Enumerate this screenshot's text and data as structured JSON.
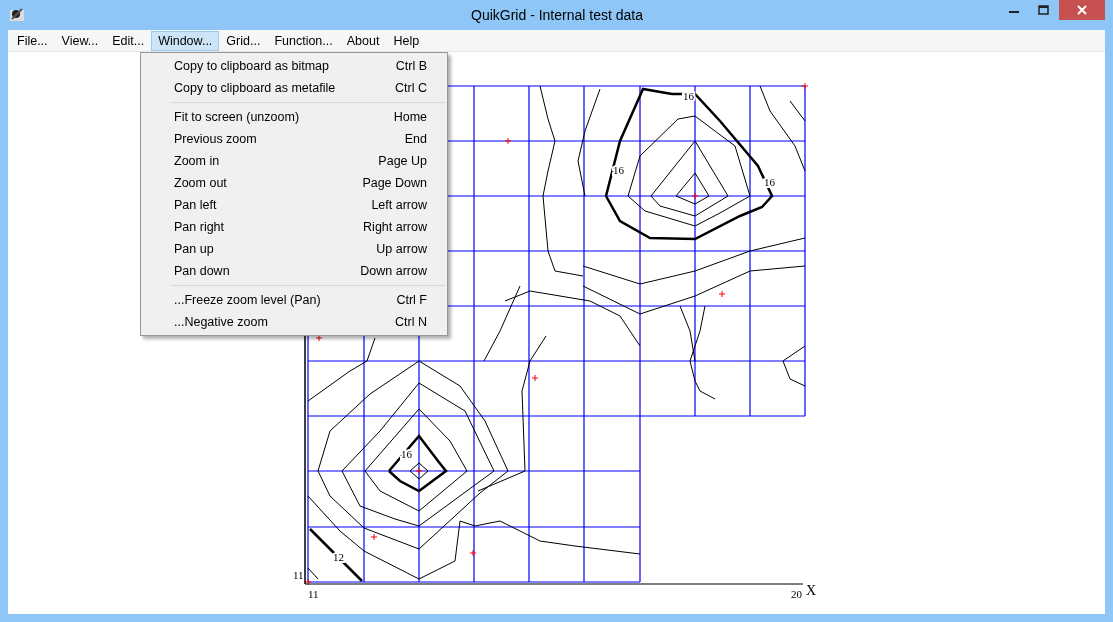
{
  "window": {
    "title": "QuikGrid - Internal test data"
  },
  "menu_bar": [
    {
      "label": "File...",
      "selected": false
    },
    {
      "label": "View...",
      "selected": false
    },
    {
      "label": "Edit...",
      "selected": false
    },
    {
      "label": "Window...",
      "selected": true
    },
    {
      "label": "Grid...",
      "selected": false
    },
    {
      "label": "Function...",
      "selected": false
    },
    {
      "label": "About",
      "selected": false
    },
    {
      "label": "Help",
      "selected": false
    }
  ],
  "dropdown": {
    "groups": [
      [
        {
          "label": "Copy to clipboard as bitmap",
          "shortcut": "Ctrl B"
        },
        {
          "label": "Copy to clipboard as metafile",
          "shortcut": "Ctrl C"
        }
      ],
      [
        {
          "label": "Fit to screen (unzoom)",
          "shortcut": "Home"
        },
        {
          "label": "Previous zoom",
          "shortcut": "End"
        },
        {
          "label": "Zoom in",
          "shortcut": "Page Up"
        },
        {
          "label": "Zoom out",
          "shortcut": "Page Down"
        },
        {
          "label": "Pan left",
          "shortcut": "Left arrow"
        },
        {
          "label": "Pan right",
          "shortcut": "Right arrow"
        },
        {
          "label": "Pan up",
          "shortcut": "Up arrow"
        },
        {
          "label": "Pan down",
          "shortcut": "Down arrow"
        }
      ],
      [
        {
          "label": "...Freeze zoom level (Pan)",
          "shortcut": "Ctrl F"
        },
        {
          "label": "...Negative zoom",
          "shortcut": "Ctrl N"
        }
      ]
    ]
  },
  "plot": {
    "contour_labels": [
      "16",
      "16",
      "16",
      "16",
      "12"
    ],
    "y_label": "11",
    "x_min_label": "11",
    "x_max_label": "20",
    "x_axis_title": "X"
  }
}
